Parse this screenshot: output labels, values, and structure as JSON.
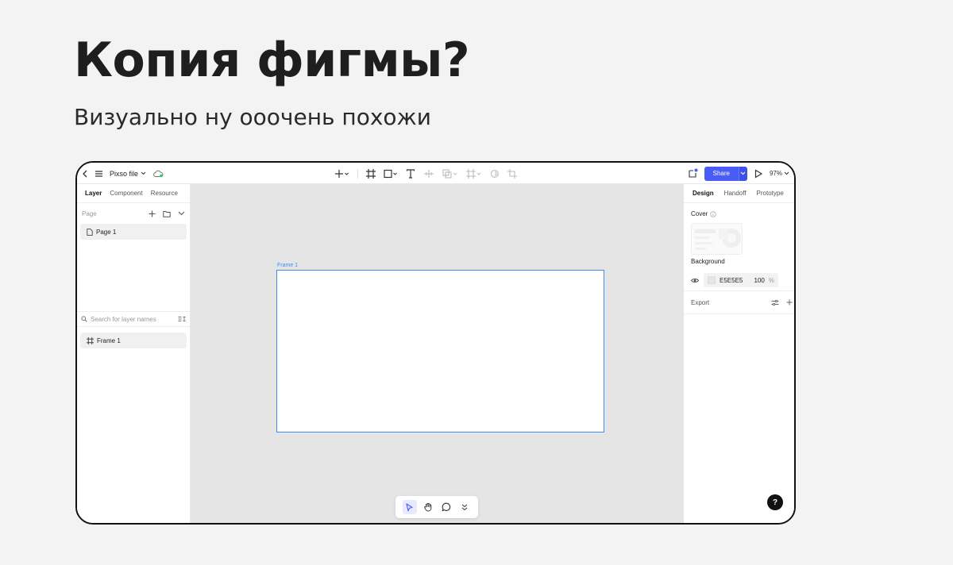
{
  "slide": {
    "title": "Копия фигмы?",
    "subtitle": "Визуально ну ooочень похожи"
  },
  "topbar": {
    "file_name": "Pixso file",
    "share_label": "Share",
    "zoom": "97%"
  },
  "left_panel": {
    "tabs": [
      "Layer",
      "Component",
      "Resource"
    ],
    "active_tab": "Layer",
    "page_section_label": "Page",
    "pages": [
      "Page 1"
    ],
    "search_placeholder": "Search for layer names",
    "layers": [
      "Frame 1"
    ]
  },
  "canvas": {
    "frame_label": "Frame 1",
    "background": "#e5e5e5",
    "frame_border_color": "#3d8ef0"
  },
  "right_panel": {
    "tabs": [
      "Design",
      "Handoff",
      "Prototype"
    ],
    "active_tab": "Design",
    "cover_label": "Cover",
    "background_label": "Background",
    "background_hex": "E5E5E5",
    "background_opacity": "100",
    "opacity_unit": "%",
    "export_label": "Export"
  },
  "help_label": "?",
  "colors": {
    "accent": "#4a5cf6",
    "page_bg": "#f3f3f3"
  }
}
